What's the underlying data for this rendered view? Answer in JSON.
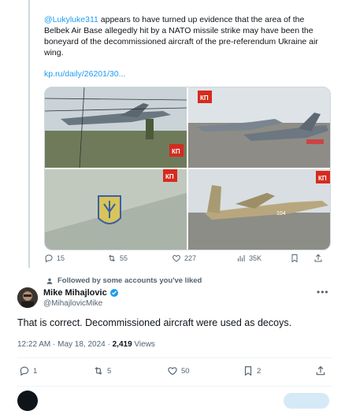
{
  "quoted_post": {
    "mention": "@Lukyluke311",
    "text": " appears to have turned up evidence that the area of the Belbek Air Base allegedly hit by a NATO missile strike may have been the boneyard of the decommissioned aircraft of the pre-referendum Ukraine air wing.",
    "link": "kp.ru/daily/26201/30...",
    "media_watermark": "КП",
    "actions": {
      "replies": "15",
      "reposts": "55",
      "likes": "227",
      "views": "35K"
    }
  },
  "social_context": "Followed by some accounts you've liked",
  "author": {
    "name": "Mike Mihajlovic",
    "handle": "@MihajlovicMike"
  },
  "post": {
    "text": "That is correct. Decommissioned aircraft were used as decoys.",
    "time": "12:22 AM · May 18, 2024 · ",
    "views_count": "2,419",
    "views_label": " Views"
  },
  "post_actions": {
    "replies": "1",
    "reposts": "5",
    "likes": "50",
    "bookmarks": "2"
  },
  "colors": {
    "accent": "#1d9bf0",
    "secondary_text": "#536471",
    "primary_text": "#0f1419",
    "verified": "#1d9bf0"
  }
}
